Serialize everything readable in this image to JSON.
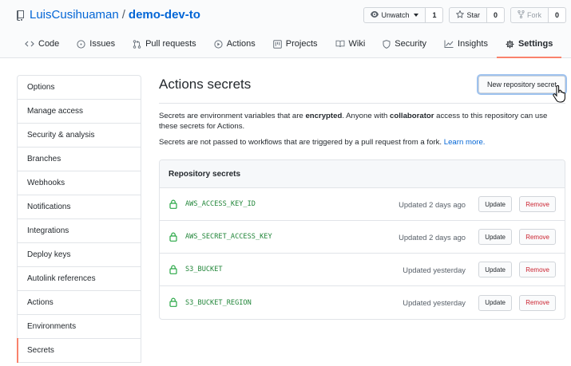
{
  "repo": {
    "owner": "LuisCusihuaman",
    "separator": "/",
    "name": "demo-dev-to"
  },
  "head_actions": {
    "watch_label": "Unwatch",
    "watch_count": "1",
    "star_label": "Star",
    "star_count": "0",
    "fork_label": "Fork",
    "fork_count": "0"
  },
  "tabs": [
    {
      "label": "Code",
      "icon": "code-icon"
    },
    {
      "label": "Issues",
      "icon": "issue-icon"
    },
    {
      "label": "Pull requests",
      "icon": "pull-request-icon"
    },
    {
      "label": "Actions",
      "icon": "play-icon"
    },
    {
      "label": "Projects",
      "icon": "project-icon"
    },
    {
      "label": "Wiki",
      "icon": "book-icon"
    },
    {
      "label": "Security",
      "icon": "shield-icon"
    },
    {
      "label": "Insights",
      "icon": "graph-icon"
    },
    {
      "label": "Settings",
      "icon": "gear-icon",
      "active": true
    }
  ],
  "sidebar": {
    "items": [
      {
        "label": "Options"
      },
      {
        "label": "Manage access"
      },
      {
        "label": "Security & analysis"
      },
      {
        "label": "Branches"
      },
      {
        "label": "Webhooks"
      },
      {
        "label": "Notifications"
      },
      {
        "label": "Integrations"
      },
      {
        "label": "Deploy keys"
      },
      {
        "label": "Autolink references"
      },
      {
        "label": "Actions"
      },
      {
        "label": "Environments"
      },
      {
        "label": "Secrets",
        "selected": true
      }
    ]
  },
  "main": {
    "title": "Actions secrets",
    "new_secret_label": "New repository secret",
    "desc_part1": "Secrets are environment variables that are ",
    "desc_bold1": "encrypted",
    "desc_part2": ". Anyone with ",
    "desc_bold2": "collaborator",
    "desc_part3": " access to this repository can use these secrets for Actions.",
    "desc2_text": "Secrets are not passed to workflows that are triggered by a pull request from a fork. ",
    "learn_more": "Learn more.",
    "box_title": "Repository secrets",
    "update_label": "Update",
    "remove_label": "Remove",
    "secrets": [
      {
        "name": "AWS_ACCESS_KEY_ID",
        "updated": "Updated 2 days ago"
      },
      {
        "name": "AWS_SECRET_ACCESS_KEY",
        "updated": "Updated 2 days ago"
      },
      {
        "name": "S3_BUCKET",
        "updated": "Updated yesterday"
      },
      {
        "name": "S3_BUCKET_REGION",
        "updated": "Updated yesterday"
      }
    ]
  },
  "colors": {
    "link": "#0366d6",
    "active_tab_underline": "#f9826c",
    "secret_name": "#22863a",
    "remove": "#cb2431"
  }
}
